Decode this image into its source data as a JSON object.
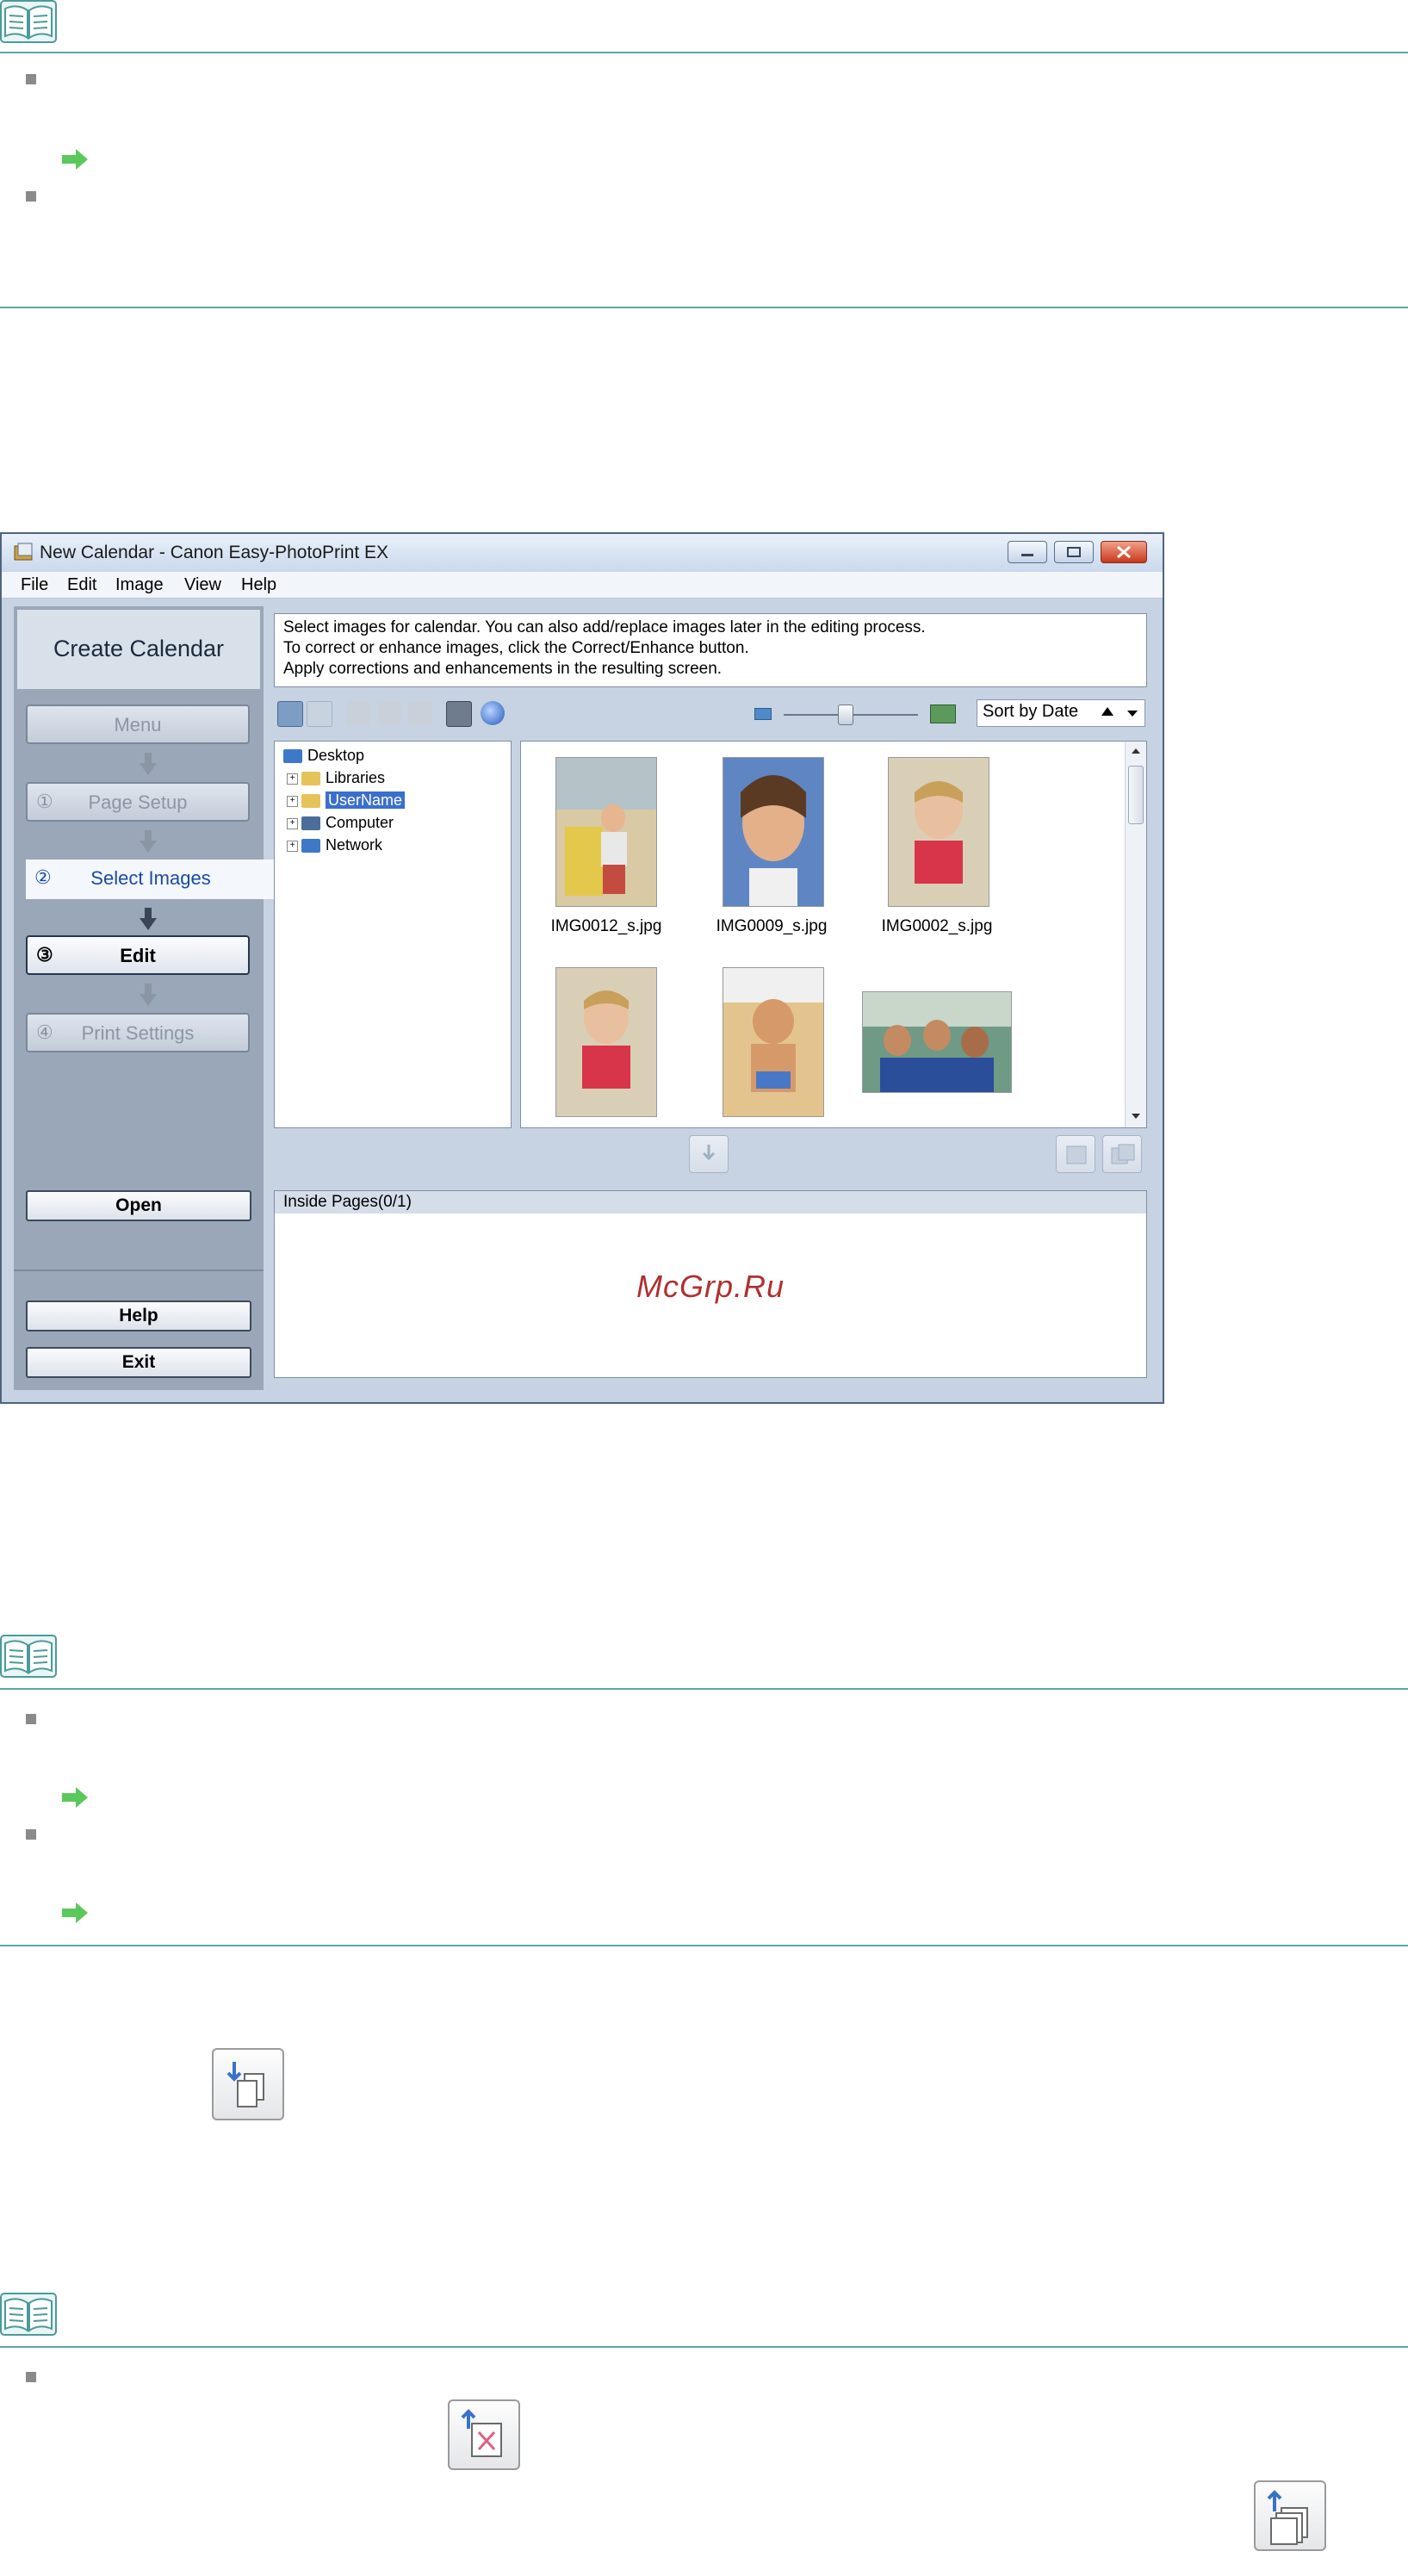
{
  "window": {
    "title": "New Calendar - Canon Easy-PhotoPrint EX",
    "menu": [
      "File",
      "Edit",
      "Image",
      "View",
      "Help"
    ]
  },
  "sidebar": {
    "header": "Create Calendar",
    "menu_button": "Menu",
    "steps": [
      {
        "num": "①",
        "label": "Page Setup"
      },
      {
        "num": "②",
        "label": "Select Images"
      },
      {
        "num": "③",
        "label": "Edit"
      },
      {
        "num": "④",
        "label": "Print Settings"
      }
    ],
    "open_button": "Open",
    "help_button": "Help",
    "exit_button": "Exit"
  },
  "instructions": [
    "Select images for calendar. You can also add/replace images later in the editing process.",
    "To correct or enhance images, click the Correct/Enhance button.",
    "Apply corrections and enhancements in the resulting screen."
  ],
  "toolbar": {
    "sort_label": "Sort by Date",
    "thumbnail_size_level": 0.45
  },
  "tree": {
    "items": [
      "Desktop",
      "Libraries",
      "UserName",
      "Computer",
      "Network"
    ],
    "selected": "UserName"
  },
  "thumbnails": {
    "captions": [
      "IMG0012_s.jpg",
      "IMG0009_s.jpg",
      "IMG0002_s.jpg"
    ]
  },
  "inside_pages": {
    "header": "Inside Pages(0/1)",
    "watermark": "McGrp.Ru"
  },
  "colors": {
    "rule": "#5aa6a6",
    "link_arrow": "#5bc85b",
    "watermark": "#b03030"
  }
}
